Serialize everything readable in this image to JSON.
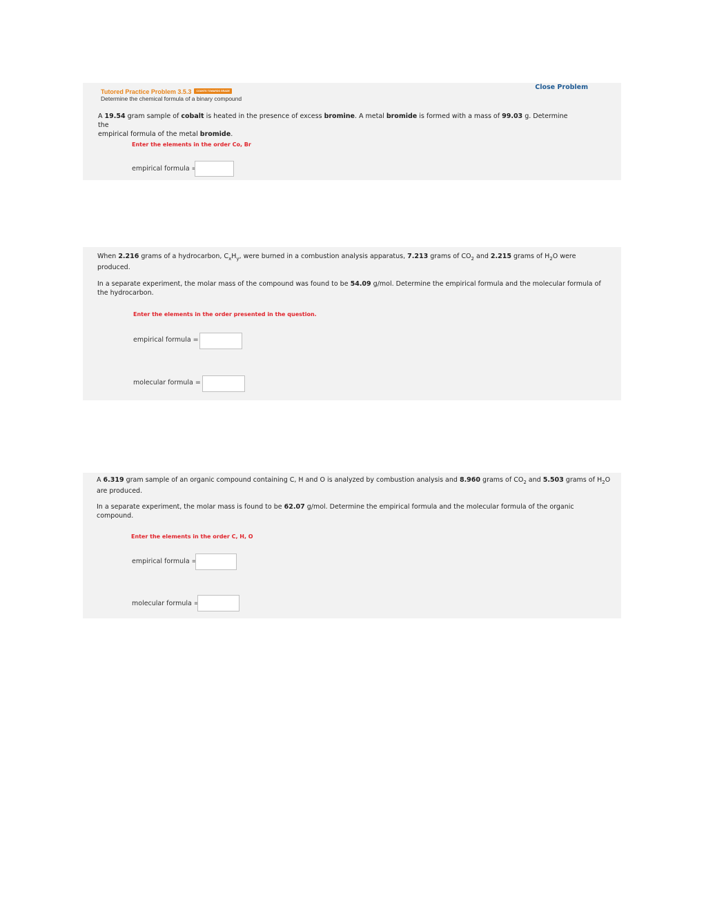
{
  "problem1": {
    "title": "Tutored Practice Problem 3.5.3",
    "badge": "COUNTS TOWARDS GRADE",
    "close": "Close Problem",
    "subtitle": "Determine the chemical formula of a binary compound",
    "q_a": "A ",
    "mass": "19.54",
    "q_b": " gram sample of ",
    "metal": "cobalt",
    "q_c": " is heated in the presence of excess ",
    "bromine": "bromine",
    "q_d": ". A metal ",
    "bromide": "bromide",
    "q_e": " is formed with a mass of ",
    "product_mass": "99.03",
    "q_f": " g. Determine the",
    "q_g": "empirical formula of the metal ",
    "bromide2": "bromide",
    "q_h": ".",
    "hint": "Enter the elements in the order Co, Br",
    "label_empirical": "empirical formula ="
  },
  "problem2": {
    "l1_a": "When ",
    "mass": "2.216",
    "l1_b": " grams of a hydrocarbon, C",
    "sub_x": "x",
    "l1_c": "H",
    "sub_y": "y",
    "l1_d": ", were burned in a combustion analysis apparatus, ",
    "co2_mass": "7.213",
    "l1_e": " grams of CO",
    "sub2a": "2",
    "l1_f": " and ",
    "h2o_mass": "2.215",
    "l1_g": " grams of H",
    "sub2b": "2",
    "l1_h": "O were",
    "l2": "produced.",
    "l3_a": "In a separate experiment, the molar mass of the compound was found to be ",
    "molar_mass": "54.09",
    "l3_b": " g/mol. Determine the empirical formula and the molecular formula of",
    "l4": "the hydrocarbon.",
    "hint": "Enter the elements in the order presented in the question.",
    "label_empirical": "empirical formula =",
    "label_molecular": "molecular formula ="
  },
  "problem3": {
    "l1_a": "A ",
    "mass": "6.319",
    "l1_b": " gram sample of an organic compound containing C, H and O is analyzed by combustion analysis and ",
    "co2_mass": "8.960",
    "l1_c": " grams of CO",
    "sub2a": "2",
    "l1_d": " and ",
    "h2o_mass": "5.503",
    "l1_e": " grams of H",
    "sub2b": "2",
    "l1_f": "O",
    "l2": "are produced.",
    "l3_a": "In a separate experiment, the molar mass is found to be ",
    "molar_mass": "62.07",
    "l3_b": " g/mol. Determine the empirical formula and the molecular formula of the organic",
    "l4": "compound.",
    "hint": "Enter the elements in the order C, H, O",
    "label_empirical": "empirical formula =",
    "label_molecular": "molecular formula ="
  }
}
